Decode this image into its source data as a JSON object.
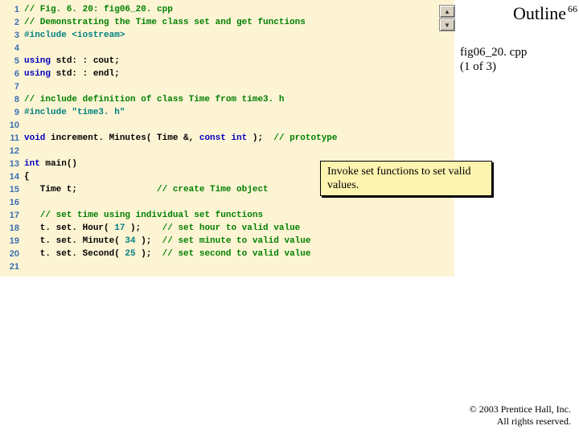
{
  "page_no": "66",
  "outline_label": "Outline",
  "file_label_line1": "fig06_20. cpp",
  "file_label_line2": "(1 of 3)",
  "callout_text": "Invoke set functions to set valid values.",
  "copyright_line1": "© 2003 Prentice Hall, Inc.",
  "copyright_line2": "All rights reserved.",
  "nav_up": "▲",
  "nav_down": "▼",
  "code": [
    {
      "n": "1",
      "seg": [
        {
          "c": "cmt",
          "t": "// Fig. 6. 20: fig06_20. cpp"
        }
      ]
    },
    {
      "n": "2",
      "seg": [
        {
          "c": "cmt",
          "t": "// Demonstrating the Time class set and get functions"
        }
      ]
    },
    {
      "n": "3",
      "seg": [
        {
          "c": "pre",
          "t": "#include "
        },
        {
          "c": "pre",
          "t": "<iostream>"
        }
      ]
    },
    {
      "n": "4",
      "seg": []
    },
    {
      "n": "5",
      "seg": [
        {
          "c": "kw",
          "t": "using"
        },
        {
          "c": "",
          "t": " std: : cout;"
        }
      ]
    },
    {
      "n": "6",
      "seg": [
        {
          "c": "kw",
          "t": "using"
        },
        {
          "c": "",
          "t": " std: : endl;"
        }
      ]
    },
    {
      "n": "7",
      "seg": []
    },
    {
      "n": "8",
      "seg": [
        {
          "c": "cmt",
          "t": "// include definition of class Time from time3. h"
        }
      ]
    },
    {
      "n": "9",
      "seg": [
        {
          "c": "pre",
          "t": "#include "
        },
        {
          "c": "str",
          "t": "\"time3. h\""
        }
      ]
    },
    {
      "n": "10",
      "seg": []
    },
    {
      "n": "11",
      "seg": [
        {
          "c": "kw",
          "t": "void"
        },
        {
          "c": "",
          "t": " increment. Minutes( Time &, "
        },
        {
          "c": "kw",
          "t": "const int"
        },
        {
          "c": "",
          "t": " );  "
        },
        {
          "c": "cmt",
          "t": "// prototype"
        }
      ]
    },
    {
      "n": "12",
      "seg": []
    },
    {
      "n": "13",
      "seg": [
        {
          "c": "kw",
          "t": "int"
        },
        {
          "c": "",
          "t": " main()"
        }
      ]
    },
    {
      "n": "14",
      "seg": [
        {
          "c": "",
          "t": "{"
        }
      ]
    },
    {
      "n": "15",
      "seg": [
        {
          "c": "",
          "t": "   Time t;               "
        },
        {
          "c": "cmt",
          "t": "// create Time object"
        }
      ]
    },
    {
      "n": "16",
      "seg": []
    },
    {
      "n": "17",
      "seg": [
        {
          "c": "",
          "t": "   "
        },
        {
          "c": "cmt",
          "t": "// set time using individual set functions"
        }
      ]
    },
    {
      "n": "18",
      "seg": [
        {
          "c": "",
          "t": "   t. set. Hour( "
        },
        {
          "c": "str",
          "t": "17"
        },
        {
          "c": "",
          "t": " );    "
        },
        {
          "c": "cmt",
          "t": "// set hour to valid value"
        }
      ]
    },
    {
      "n": "19",
      "seg": [
        {
          "c": "",
          "t": "   t. set. Minute( "
        },
        {
          "c": "str",
          "t": "34"
        },
        {
          "c": "",
          "t": " );  "
        },
        {
          "c": "cmt",
          "t": "// set minute to valid value"
        }
      ]
    },
    {
      "n": "20",
      "seg": [
        {
          "c": "",
          "t": "   t. set. Second( "
        },
        {
          "c": "str",
          "t": "25"
        },
        {
          "c": "",
          "t": " );  "
        },
        {
          "c": "cmt",
          "t": "// set second to valid value"
        }
      ]
    },
    {
      "n": "21",
      "seg": []
    }
  ]
}
